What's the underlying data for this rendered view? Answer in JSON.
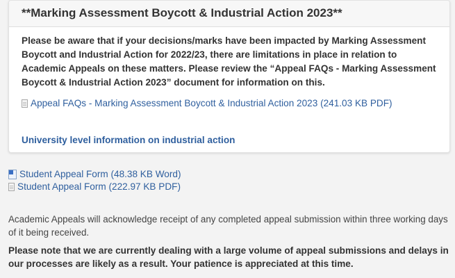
{
  "panel": {
    "title": "**Marking Assessment Boycott & Industrial Action 2023**",
    "notice": "Please be aware that if your decisions/marks have been impacted by Marking Assessment Boycott and Industrial Action for 2022/23, there are limitations in place in relation to Academic Appeals on these matters. Please review the “Appeal FAQs - Marking Assessment Boycott & Industrial Action 2023” document for information on this.",
    "faq_link": "Appeal FAQs - Marking Assessment Boycott & Industrial Action 2023 (241.03 KB PDF)",
    "university_link": "University level information on industrial action"
  },
  "downloads": [
    {
      "label": "Student Appeal Form (48.38 KB Word)",
      "icon": "word-doc-icon"
    },
    {
      "label": "Student Appeal Form (222.97 KB PDF)",
      "icon": "pdf-doc-icon"
    }
  ],
  "acknowledgement": "Academic Appeals will acknowledge receipt of any completed appeal submission within three working days of it being received.",
  "volume_notice": "Please note that we are currently dealing with a large volume of appeal submissions and delays in our processes are likely as a result. Your patience is appreciated at this time.",
  "colors": {
    "link": "#2f5f9e",
    "page_background": "#f3f3f3",
    "panel_background": "#ffffff",
    "text": "#333333"
  }
}
